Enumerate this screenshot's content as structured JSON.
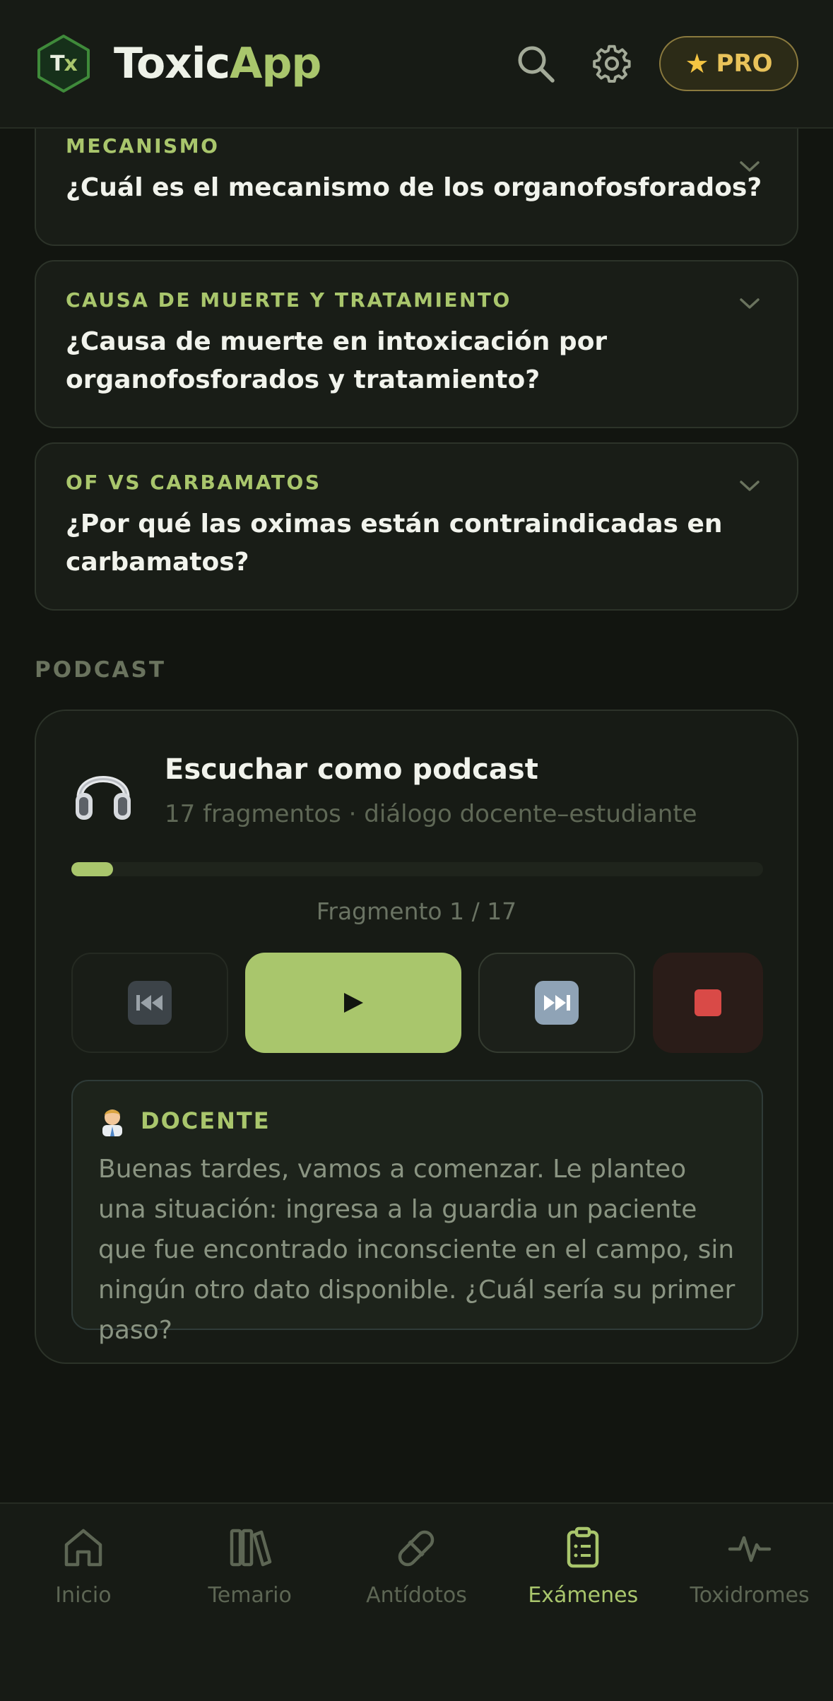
{
  "app": {
    "logo_initials": "Tx",
    "brand_part1": "Toxic",
    "brand_part2": "App",
    "pro_label": "PRO"
  },
  "questions": [
    {
      "tag": "MECANISMO",
      "question": "¿Cuál es el mecanismo de los organofosforados?"
    },
    {
      "tag": "CAUSA DE MUERTE Y TRATAMIENTO",
      "question": "¿Causa de muerte en intoxicación por organofosforados y tratamiento?"
    },
    {
      "tag": "OF VS CARBAMATOS",
      "question": "¿Por qué las oximas están contraindicadas en carbamatos?"
    }
  ],
  "podcast": {
    "section_label": "PODCAST",
    "title": "Escuchar como podcast",
    "subtitle": "17 fragmentos · diálogo docente–estudiante",
    "fragment_label": "Fragmento 1 / 17",
    "progress_fraction": 0.06,
    "controls": {
      "prev_icon": "previous-track-icon",
      "play_icon": "play-icon",
      "next_icon": "next-track-icon",
      "stop_icon": "stop-icon"
    },
    "dialog": {
      "speaker": "DOCENTE",
      "speaker_icon": "teacher-emoji-icon",
      "text": "Buenas tardes, vamos a comenzar. Le planteo una situación: ingresa a la guardia un paciente que fue encontrado inconsciente en el campo, sin ningún otro dato disponible. ¿Cuál sería su primer paso?"
    }
  },
  "nav": [
    {
      "label": "Inicio",
      "icon": "home-icon",
      "active": false
    },
    {
      "label": "Temario",
      "icon": "books-icon",
      "active": false
    },
    {
      "label": "Antídotos",
      "icon": "pill-icon",
      "active": false
    },
    {
      "label": "Exámenes",
      "icon": "clipboard-icon",
      "active": true
    },
    {
      "label": "Toxidromes",
      "icon": "pulse-icon",
      "active": false
    }
  ],
  "colors": {
    "accent": "#a9c66c",
    "background": "#121510",
    "stop": "#d94a47",
    "pro": "#e8c25a"
  }
}
